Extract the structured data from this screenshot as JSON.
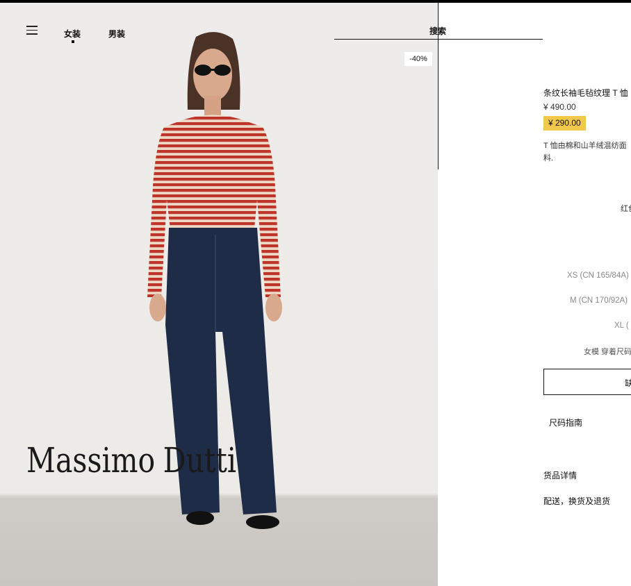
{
  "nav": {
    "menu_icon": "hamburger-icon",
    "women": "女装",
    "men": "男装",
    "search": "搜索"
  },
  "badge": {
    "discount": "-40%"
  },
  "brand": {
    "logo_word1": "Massimo",
    "logo_word2": "Dutti"
  },
  "product": {
    "title": "条纹长袖毛毡纹理 T 恤",
    "original_price": "¥ 490.00",
    "sale_price": "¥ 290.00",
    "description": "T 恤由棉和山羊绒混纺面料.",
    "color": "红色",
    "sizes": [
      "XS (CN 165/84A)",
      "M (CN 170/92A)",
      "XL ("
    ],
    "model_size": "女模 穿着尺码",
    "add_button": "缺",
    "size_guide": "尺码指南",
    "details": "货品详情",
    "shipping": "配送，换货及退货"
  },
  "colors": {
    "sale_highlight": "#f1c84b",
    "stripe_red": "#c0352b",
    "denim": "#1f2c47"
  }
}
